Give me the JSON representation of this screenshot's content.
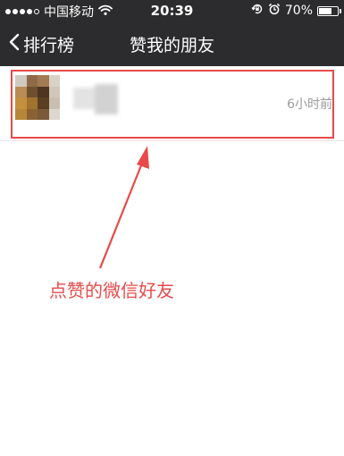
{
  "status_bar": {
    "carrier": "中国移动",
    "time": "20:39",
    "battery_percent": "70%",
    "battery_level": 0.7,
    "signal_bars_filled": 4,
    "signal_bars_total": 5
  },
  "nav": {
    "back_label": "排行榜",
    "title": "赞我的朋友"
  },
  "likers": [
    {
      "time": "6小时前"
    }
  ],
  "annotation": {
    "text": "点赞的微信好友"
  },
  "colors": {
    "bar_background": "#2c2c2e",
    "annotation_red": "#e84a4a",
    "secondary_text": "#9a9a9a"
  },
  "icons": {
    "signal": "signal-dots-icon",
    "wifi": "wifi-icon",
    "lock": "orientation-lock-icon",
    "alarm": "alarm-icon",
    "battery": "battery-icon",
    "back": "chevron-left-icon"
  }
}
